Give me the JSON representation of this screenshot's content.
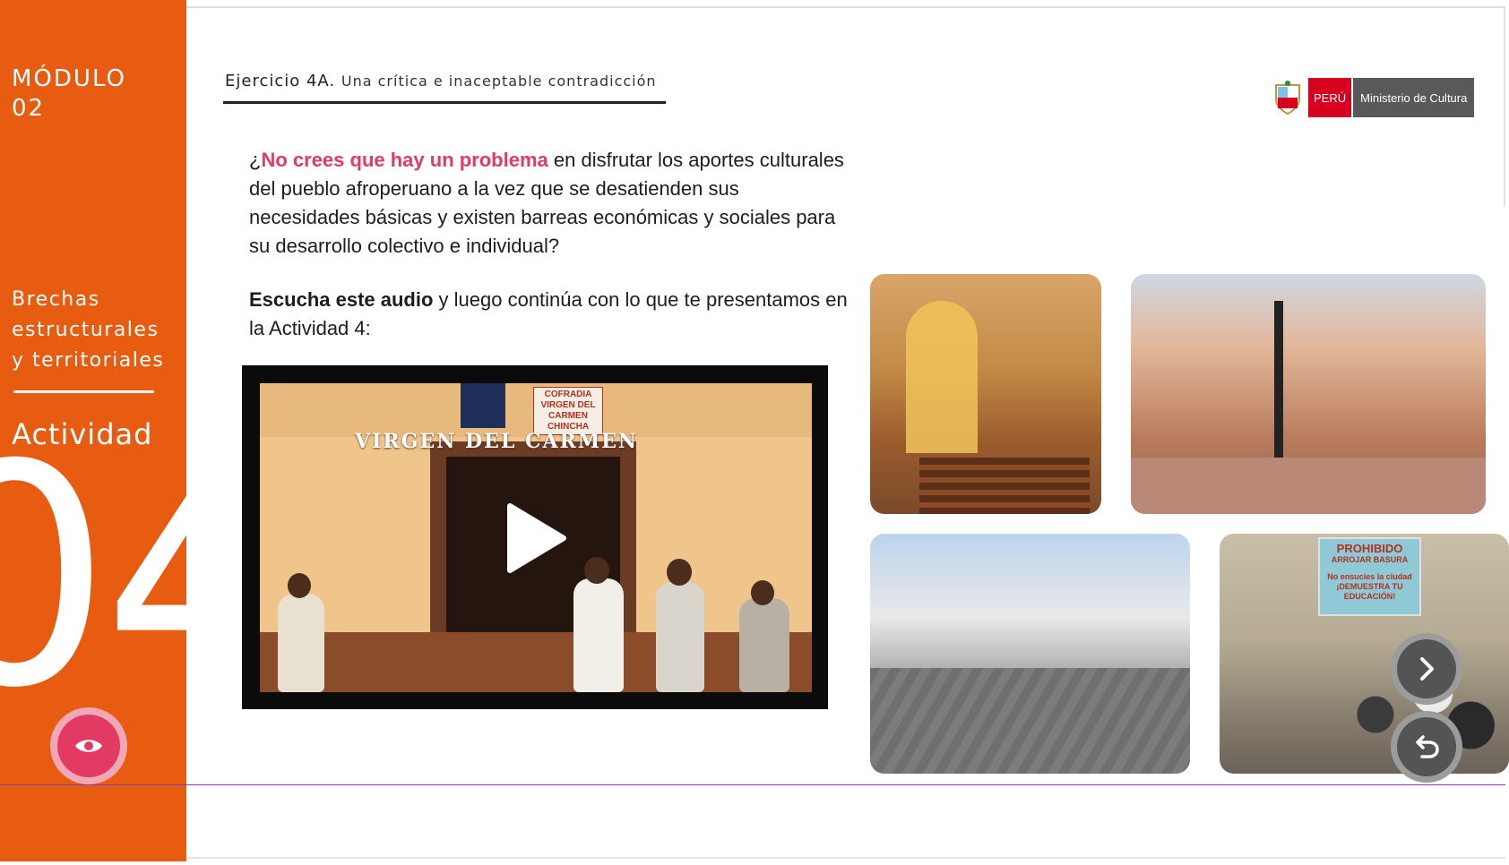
{
  "sidebar": {
    "module_line1": "MÓDULO",
    "module_line2": "02",
    "section_line1": "Brechas",
    "section_line2": "estructurales",
    "section_line3": "y territoriales",
    "activity_label": "Actividad",
    "activity_number": "04",
    "eye_icon": "eye-icon"
  },
  "header": {
    "exercise_label": "Ejercicio 4A",
    "exercise_title": "Una crítica e inaceptable contradicción",
    "logo_peru": "PERÚ",
    "logo_ministry": "Ministerio de Cultura"
  },
  "content": {
    "q_open": "¿",
    "q_highlight": "No crees que hay un problema",
    "q_rest": " en disfrutar los aportes culturales del pueblo afroperuano a la vez que se desatienden sus necesidades básicas y existen barreas económicas y sociales para su desarrollo colectivo e individual?",
    "listen_bold": "Escucha este audio",
    "listen_rest": " y luego continúa con lo que te presentamos en la Actividad 4:"
  },
  "video": {
    "sign": "VIRGEN DEL CARMEN",
    "cofradia_line1": "COFRADIA",
    "cofradia_line2": "VIRGEN DEL CARMEN",
    "cofradia_line3": "CHINCHA",
    "play_icon": "play-icon"
  },
  "photos": {
    "sign_line1": "PROHIBIDO",
    "sign_line2": "ARROJAR BASURA",
    "sign_line3": "No ensucies la ciudad",
    "sign_line4": "¡DEMUESTRA TU EDUCACIÓN!"
  },
  "nav": {
    "next_icon": "chevron-right-icon",
    "undo_icon": "undo-icon"
  },
  "colors": {
    "sidebar": "#e85c12",
    "accent_pink": "#e23a63",
    "logo_red": "#d7001e"
  }
}
